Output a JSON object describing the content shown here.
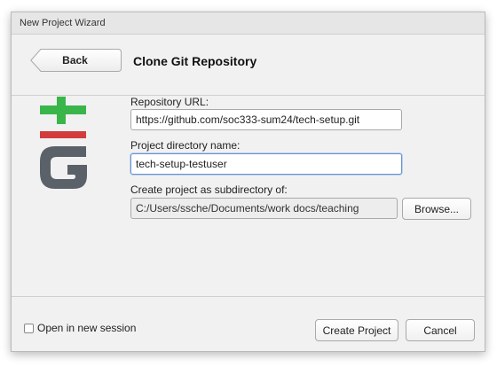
{
  "window": {
    "title": "New Project Wizard"
  },
  "header": {
    "back_label": "Back",
    "title": "Clone Git Repository"
  },
  "form": {
    "repo_url_label": "Repository URL:",
    "repo_url_value": "https://github.com/soc333-sum24/tech-setup.git",
    "dir_name_label": "Project directory name:",
    "dir_name_value": "tech-setup-testuser",
    "subdir_label": "Create project as subdirectory of:",
    "subdir_value": "C:/Users/ssche/Documents/work docs/teaching",
    "browse_label": "Browse..."
  },
  "footer": {
    "open_new_session_label": "Open in new session",
    "open_new_session_checked": false,
    "create_label": "Create Project",
    "cancel_label": "Cancel"
  },
  "logo": {
    "icon": "git-logo-icon",
    "green": "#3ab54a",
    "red": "#d33c3c",
    "gray": "#5a6169"
  }
}
